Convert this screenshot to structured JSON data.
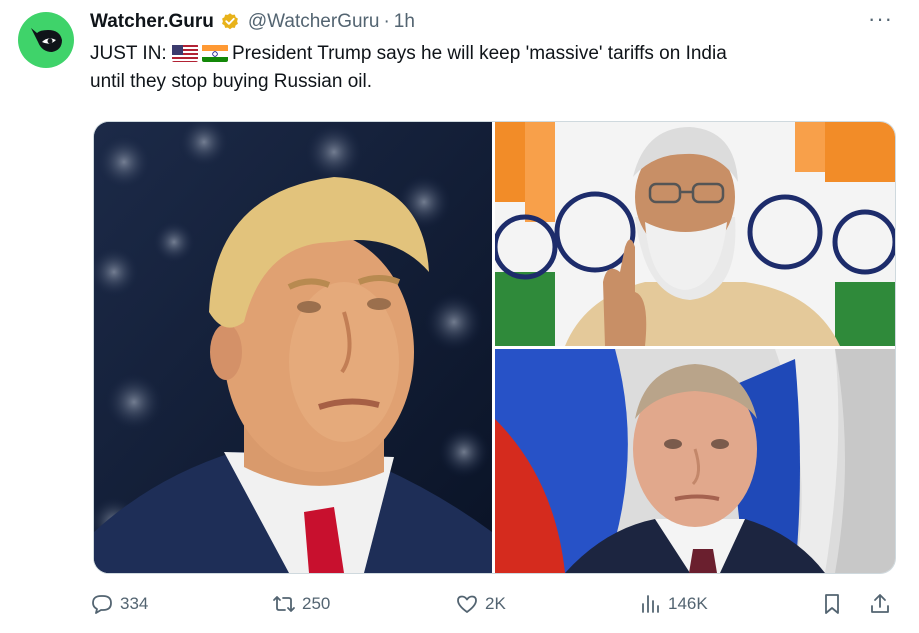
{
  "tweet": {
    "author_name": "Watcher.Guru",
    "handle": "@WatcherGuru",
    "separator": "·",
    "time": "1h",
    "text_prefix": "JUST IN: ",
    "text_line1_rest": "President Trump says he will keep 'massive' tariffs on India",
    "text_line2": "until they stop buying Russian oil.",
    "more_label": "···"
  },
  "actions": {
    "replies": "334",
    "retweets": "250",
    "likes": "2K",
    "views": "146K"
  },
  "icons": {
    "avatar": "watcher-logo-icon",
    "verified": "verified-badge-icon",
    "reply": "reply-icon",
    "retweet": "retweet-icon",
    "like": "heart-icon",
    "views": "views-icon",
    "bookmark": "bookmark-icon",
    "share": "share-icon"
  },
  "colors": {
    "avatar_bg": "#3fd36a",
    "verified_gold": "#e8b21a",
    "muted_text": "#536471"
  }
}
